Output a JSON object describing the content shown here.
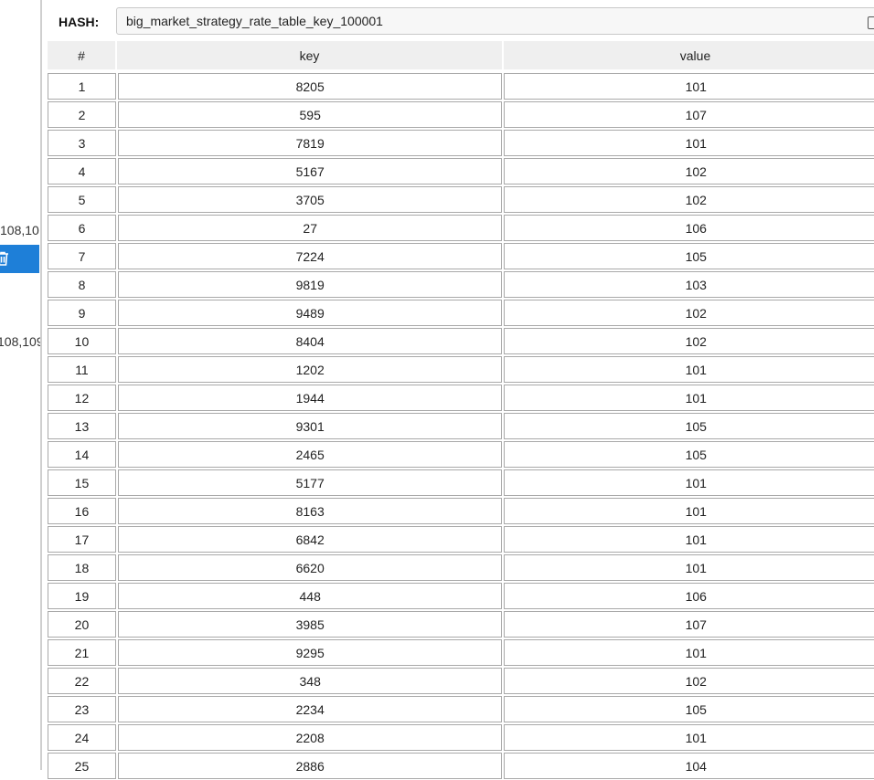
{
  "left_panel": {
    "text_1": "108,10",
    "text_2": "108,109"
  },
  "hash": {
    "label": "HASH:",
    "value": "big_market_strategy_rate_table_key_100001"
  },
  "table": {
    "columns": [
      "#",
      "key",
      "value"
    ],
    "rows": [
      [
        "1",
        "8205",
        "101"
      ],
      [
        "2",
        "595",
        "107"
      ],
      [
        "3",
        "7819",
        "101"
      ],
      [
        "4",
        "5167",
        "102"
      ],
      [
        "5",
        "3705",
        "102"
      ],
      [
        "6",
        "27",
        "106"
      ],
      [
        "7",
        "7224",
        "105"
      ],
      [
        "8",
        "9819",
        "103"
      ],
      [
        "9",
        "9489",
        "102"
      ],
      [
        "10",
        "8404",
        "102"
      ],
      [
        "11",
        "1202",
        "101"
      ],
      [
        "12",
        "1944",
        "101"
      ],
      [
        "13",
        "9301",
        "105"
      ],
      [
        "14",
        "2465",
        "105"
      ],
      [
        "15",
        "5177",
        "101"
      ],
      [
        "16",
        "8163",
        "101"
      ],
      [
        "17",
        "6842",
        "101"
      ],
      [
        "18",
        "6620",
        "101"
      ],
      [
        "19",
        "448",
        "106"
      ],
      [
        "20",
        "3985",
        "107"
      ],
      [
        "21",
        "9295",
        "101"
      ],
      [
        "22",
        "348",
        "102"
      ],
      [
        "23",
        "2234",
        "105"
      ],
      [
        "24",
        "2208",
        "101"
      ],
      [
        "25",
        "2886",
        "104"
      ]
    ]
  },
  "colors": {
    "selection": "#1e7fd8",
    "header_bg": "#efefef",
    "cell_border": "#a9a9a9"
  }
}
